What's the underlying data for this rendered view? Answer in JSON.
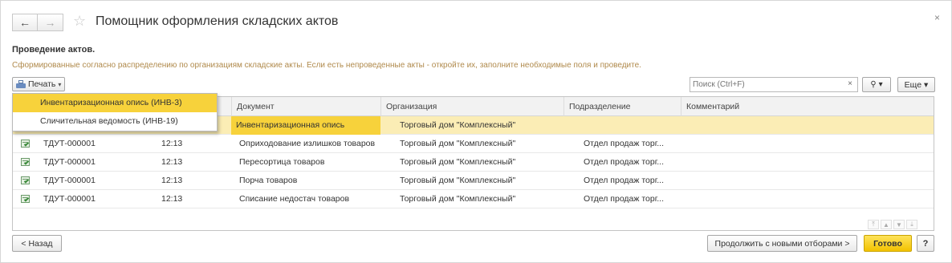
{
  "header": {
    "back_icon": "←",
    "forward_icon": "→",
    "star_icon": "☆",
    "title": "Помощник оформления складских актов",
    "close_icon": "×"
  },
  "section": {
    "title": "Проведение актов.",
    "description": "Сформированные согласно распределению по организациям складские акты. Если есть непроведенные акты - откройте их, заполните необходимые поля и проведите."
  },
  "toolbar": {
    "print_label": "Печать",
    "search_placeholder": "Поиск (Ctrl+F)",
    "search_clear": "×",
    "search_icon": "⚲",
    "dropdown_caret": "▾",
    "more_label": "Еще"
  },
  "print_menu": {
    "items": [
      {
        "label": "Инвентаризационная опись (ИНВ-3)",
        "active": true
      },
      {
        "label": "Сличительная ведомость (ИНВ-19)",
        "active": false
      }
    ]
  },
  "table": {
    "columns": [
      "Документ",
      "Организация",
      "Подразделение",
      "Комментарий"
    ],
    "rows": [
      {
        "number": "",
        "time": "",
        "document": "Инвентаризационная опись",
        "organization": "Торговый дом \"Комплексный\"",
        "department": "",
        "comment": "",
        "selected": true
      },
      {
        "number": "ТДУТ-000001",
        "time": "12:13",
        "document": "Оприходование излишков товаров",
        "organization": "Торговый дом \"Комплексный\"",
        "department": "Отдел продаж торг...",
        "comment": ""
      },
      {
        "number": "ТДУТ-000001",
        "time": "12:13",
        "document": "Пересортица товаров",
        "organization": "Торговый дом \"Комплексный\"",
        "department": "Отдел продаж торг...",
        "comment": ""
      },
      {
        "number": "ТДУТ-000001",
        "time": "12:13",
        "document": "Порча товаров",
        "organization": "Торговый дом \"Комплексный\"",
        "department": "Отдел продаж торг...",
        "comment": ""
      },
      {
        "number": "ТДУТ-000001",
        "time": "12:13",
        "document": "Списание недостач товаров",
        "organization": "Торговый дом \"Комплексный\"",
        "department": "Отдел продаж торг...",
        "comment": ""
      }
    ],
    "scroll_icons": [
      "⤒",
      "▲",
      "▼",
      "⤓"
    ]
  },
  "footer": {
    "back_label": "< Назад",
    "continue_label": "Продолжить с новыми отборами >",
    "done_label": "Готово",
    "help_label": "?"
  },
  "colors": {
    "accent": "#f7d23b",
    "selected_row": "#fbedb5",
    "description_text": "#b08a4c"
  }
}
